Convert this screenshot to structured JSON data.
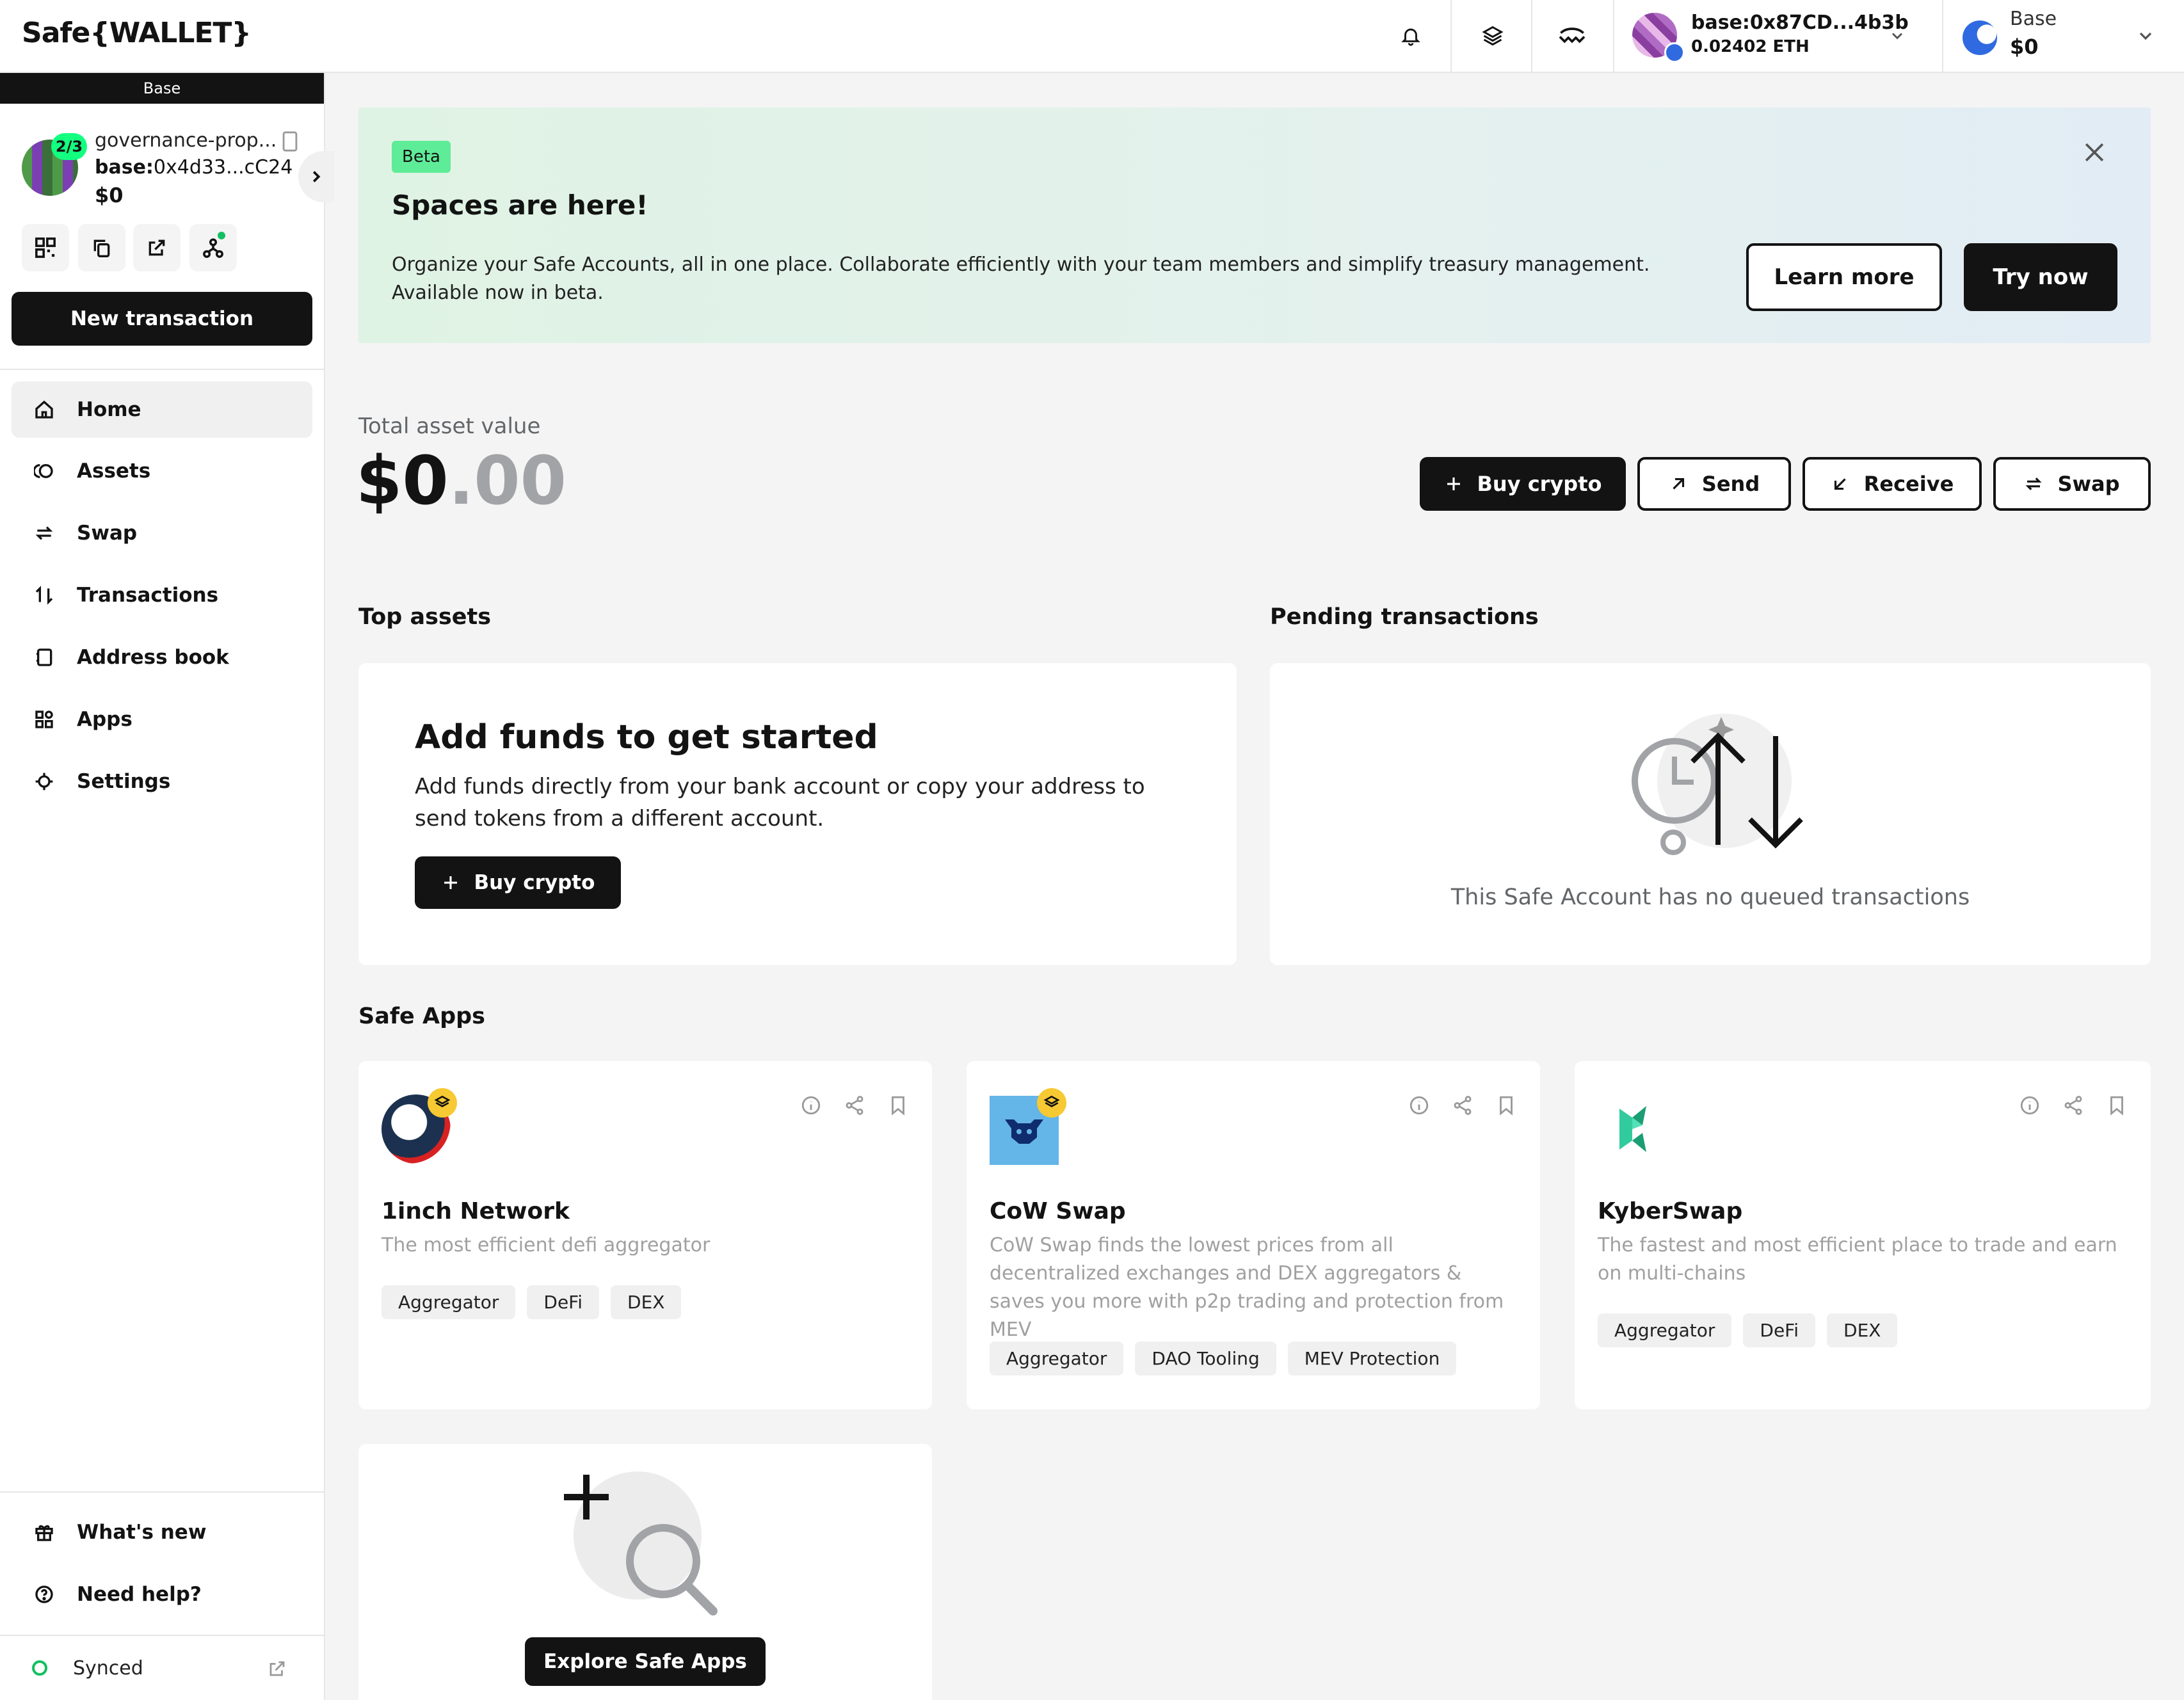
{
  "header": {
    "logo": "Safe{WALLET}",
    "wallet_address": "base:0x87CD...4b3b",
    "wallet_balance": "0.02402 ETH",
    "network_name": "Base",
    "network_balance": "$0"
  },
  "sidebar": {
    "chain_label": "Base",
    "safe_threshold": "2/3",
    "safe_name": "governance-prop...",
    "safe_address_prefix": "base:",
    "safe_address": "0x4d33...cC24",
    "safe_balance": "$0",
    "new_tx_label": "New transaction",
    "nav": [
      {
        "label": "Home",
        "icon": "home-icon"
      },
      {
        "label": "Assets",
        "icon": "assets-icon"
      },
      {
        "label": "Swap",
        "icon": "swap-icon"
      },
      {
        "label": "Transactions",
        "icon": "transactions-icon"
      },
      {
        "label": "Address book",
        "icon": "address-book-icon"
      },
      {
        "label": "Apps",
        "icon": "apps-icon"
      },
      {
        "label": "Settings",
        "icon": "settings-icon"
      }
    ],
    "whats_new": "What's new",
    "need_help": "Need help?",
    "synced": "Synced"
  },
  "banner": {
    "badge": "Beta",
    "title": "Spaces are here!",
    "text_line1": "Organize your Safe Accounts, all in one place. Collaborate efficiently with your team members and simplify treasury management.",
    "text_line2": "Available now in beta.",
    "learn_more": "Learn more",
    "try_now": "Try now"
  },
  "overview": {
    "label": "Total asset value",
    "value_main": "$0",
    "value_decimal": ".00",
    "buy_crypto": "Buy crypto",
    "send": "Send",
    "receive": "Receive",
    "swap": "Swap"
  },
  "top_assets": {
    "title": "Top assets",
    "card_title": "Add funds to get started",
    "card_text": "Add funds directly from your bank account or copy your address to send tokens from a different account.",
    "buy_crypto": "Buy crypto"
  },
  "pending": {
    "title": "Pending transactions",
    "empty_text": "This Safe Account has no queued transactions"
  },
  "safe_apps": {
    "title": "Safe Apps",
    "apps": [
      {
        "name": "1inch Network",
        "description": "The most efficient defi aggregator",
        "tags": [
          "Aggregator",
          "DeFi",
          "DEX"
        ]
      },
      {
        "name": "CoW Swap",
        "description": "CoW Swap finds the lowest prices from all decentralized exchanges and DEX aggregators & saves you more with p2p trading and protection from MEV",
        "tags": [
          "Aggregator",
          "DAO Tooling",
          "MEV Protection"
        ]
      },
      {
        "name": "KyberSwap",
        "description": "The fastest and most efficient place to trade and earn on multi-chains",
        "tags": [
          "Aggregator",
          "DeFi",
          "DEX"
        ]
      }
    ],
    "explore": "Explore Safe Apps"
  }
}
